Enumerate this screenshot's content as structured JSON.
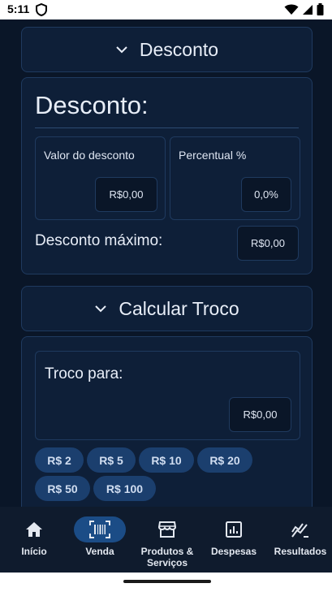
{
  "status_bar": {
    "time": "5:11",
    "icons": [
      "shield-icon",
      "wifi-icon",
      "signal-icon",
      "battery-icon"
    ]
  },
  "desconto_section": {
    "header_title": "Desconto",
    "card_title": "Desconto:",
    "valor_label": "Valor do desconto",
    "valor_value": "R$0,00",
    "percentual_label": "Percentual %",
    "percentual_value": "0,0%",
    "maximo_label": "Desconto máximo:",
    "maximo_value": "R$0,00"
  },
  "troco_section": {
    "header_title": "Calcular Troco",
    "troco_label": "Troco para:",
    "troco_value": "R$0,00",
    "chips": [
      "R$ 2",
      "R$ 5",
      "R$ 10",
      "R$ 20",
      "R$ 50",
      "R$ 100"
    ]
  },
  "bottom_nav": {
    "items": [
      {
        "label": "Início",
        "icon": "home-icon",
        "active": false
      },
      {
        "label": "Venda",
        "icon": "barcode-scanner-icon",
        "active": true
      },
      {
        "label": "Produtos & Serviços",
        "icon": "store-icon",
        "active": false
      },
      {
        "label": "Despesas",
        "icon": "bar-chart-icon",
        "active": false
      },
      {
        "label": "Resultados",
        "icon": "trending-chart-icon",
        "active": false
      }
    ]
  },
  "colors": {
    "background": "#0a1628",
    "card": "#0e1f38",
    "border": "#1f3a5f",
    "chip": "#1b3f6e",
    "nav_active": "#1b4c86"
  }
}
